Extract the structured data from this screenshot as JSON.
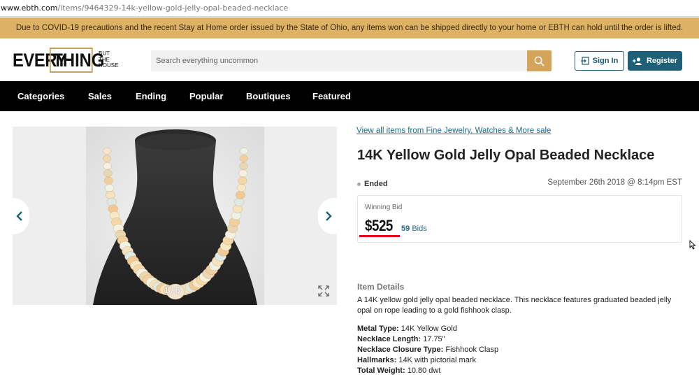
{
  "browser": {
    "url_domain": "www.ebth.com",
    "url_path": "/items/9464329-14k-yellow-gold-jelly-opal-beaded-necklace"
  },
  "banner": {
    "text": "Due to COVID-19 precautions and the recent Stay at Home order issued by the State of Ohio, any items won can be shipped directly to your home or EBTH can hold until the order is lifted.",
    "bg_color": "#ddb264"
  },
  "header": {
    "logo": {
      "word1": "EVERY",
      "word2": "THING",
      "tag1": "BUT",
      "tag2": "THE",
      "tag3": "HOUSE"
    },
    "search_placeholder": "Search everything uncommon",
    "search_icon": "search-icon",
    "sign_in_label": "Sign In",
    "register_label": "Register",
    "accent_color": "#d4a45a",
    "brand_color": "#1e6078"
  },
  "nav": {
    "items": [
      "Categories",
      "Sales",
      "Ending",
      "Popular",
      "Boutiques",
      "Featured"
    ]
  },
  "gallery": {
    "counter": "1 / 6",
    "prev_icon": "chevron-left-icon",
    "next_icon": "chevron-right-icon",
    "expand_icon": "expand-icon"
  },
  "item": {
    "breadcrumb": "View all items from Fine Jewelry, Watches & More sale",
    "title": "14K Yellow Gold Jelly Opal Beaded Necklace",
    "status": "Ended",
    "end_date": "September 26th 2018 @ 8:14pm EST",
    "winning_bid_label": "Winning Bid",
    "winning_bid": "$525",
    "bid_count": "59",
    "bids_label": "Bids",
    "details_heading": "Item Details",
    "description": "A 14K yellow gold jelly opal beaded necklace. This necklace features graduated beaded jelly opal on rope leading to a gold fishhook clasp.",
    "specs": [
      {
        "label": "Metal Type:",
        "value": " 14K Yellow Gold"
      },
      {
        "label": "Necklace Length:",
        "value": " 17.75\""
      },
      {
        "label": "Necklace Closure Type:",
        "value": " Fishhook Clasp"
      },
      {
        "label": "Hallmarks:",
        "value": " 14K with pictorial mark"
      },
      {
        "label": "Total Weight:",
        "value": " 10.80 dwt"
      }
    ]
  }
}
